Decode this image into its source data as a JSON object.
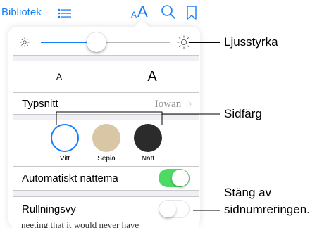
{
  "toolbar": {
    "library_label": "Bibliotek",
    "font_small": "A",
    "font_large": "A",
    "icons": [
      "list-icon",
      "font-size-icon",
      "search-icon",
      "bookmark-icon"
    ]
  },
  "settings": {
    "brightness": {
      "level": 0.35
    },
    "font_size": {
      "smaller": "A",
      "larger": "A"
    },
    "font_row": {
      "label": "Typsnitt",
      "value": "Iowan",
      "chevron": "›"
    },
    "page_colors": [
      {
        "label": "Vitt",
        "color": "#ffffff",
        "selected": true
      },
      {
        "label": "Sepia",
        "color": "#d9c6a4",
        "selected": false
      },
      {
        "label": "Natt",
        "color": "#2b2b2b",
        "selected": false
      }
    ],
    "auto_night": {
      "label": "Automatiskt nattema",
      "on": true
    },
    "scrolling": {
      "label": "Rullningsvy",
      "on": false
    }
  },
  "book_text": "neeting that it would never have",
  "colors": {
    "accent": "#157efb",
    "toggle_on": "#4cd964"
  },
  "callouts": {
    "brightness": "Ljusstyrka",
    "page_color": "Sidfärg",
    "scroll_line1": "Stäng av",
    "scroll_line2": "sidnumreringen."
  }
}
